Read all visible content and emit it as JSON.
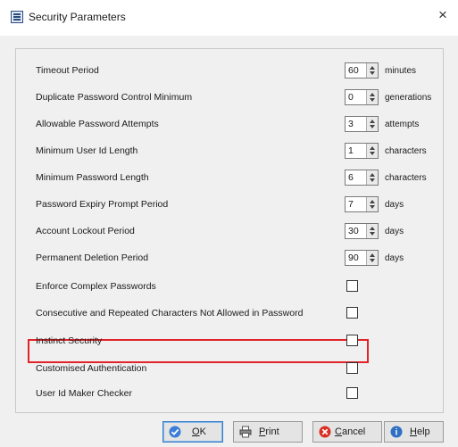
{
  "window": {
    "title": "Security Parameters",
    "close": "×"
  },
  "settings": [
    {
      "label": "Timeout Period",
      "value": "60",
      "unit": "minutes"
    },
    {
      "label": "Duplicate Password Control Minimum",
      "value": "0",
      "unit": "generations"
    },
    {
      "label": "Allowable Password Attempts",
      "value": "3",
      "unit": "attempts"
    },
    {
      "label": "Minimum User Id Length",
      "value": "1",
      "unit": "characters"
    },
    {
      "label": "Minimum Password Length",
      "value": "6",
      "unit": "characters"
    },
    {
      "label": "Password Expiry Prompt Period",
      "value": "7",
      "unit": "days"
    },
    {
      "label": "Account Lockout Period",
      "value": "30",
      "unit": "days"
    },
    {
      "label": "Permanent Deletion Period",
      "value": "90",
      "unit": "days"
    }
  ],
  "options": [
    {
      "label": "Enforce Complex Passwords",
      "checked": false
    },
    {
      "label": "Consecutive and Repeated Characters Not Allowed in Password",
      "checked": false
    },
    {
      "label": "Instinct Security",
      "checked": false,
      "highlighted": true
    },
    {
      "label": "Customised Authentication",
      "checked": false
    },
    {
      "label": "User Id Maker Checker",
      "checked": false
    }
  ],
  "buttons": {
    "ok": {
      "mnemonic": "O",
      "rest": "K"
    },
    "print": {
      "mnemonic": "P",
      "rest": "rint"
    },
    "cancel": {
      "mnemonic": "C",
      "rest": "ancel"
    },
    "help": {
      "mnemonic": "H",
      "rest": "elp"
    }
  },
  "colors": {
    "highlight": "#e0242a",
    "dialog_bg": "#f0f0f0"
  }
}
